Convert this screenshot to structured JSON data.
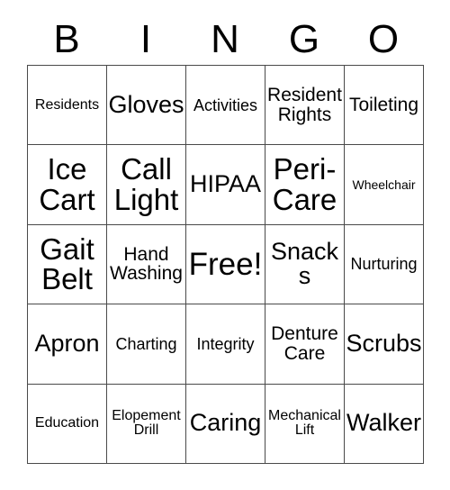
{
  "card": {
    "header_letters": [
      "B",
      "I",
      "N",
      "G",
      "O"
    ],
    "grid": {
      "rows": 5,
      "columns": 5,
      "border_color": "#4a4a4a",
      "background_color": "#ffffff",
      "text_color": "#000000"
    },
    "cells": [
      [
        {
          "label": "Residents",
          "size": "sm",
          "free": false
        },
        {
          "label": "Gloves",
          "size": "xl",
          "free": false
        },
        {
          "label": "Activities",
          "size": "md",
          "free": false
        },
        {
          "label": "Resident Rights",
          "size": "lg",
          "free": false
        },
        {
          "label": "Toileting",
          "size": "lg",
          "free": false
        }
      ],
      [
        {
          "label": "Ice Cart",
          "size": "xxl",
          "free": false
        },
        {
          "label": "Call Light",
          "size": "xxl",
          "free": false
        },
        {
          "label": "HIPAA",
          "size": "xl",
          "free": false
        },
        {
          "label": "Peri-Care",
          "size": "xxl",
          "free": false
        },
        {
          "label": "Wheelchair",
          "size": "xs",
          "free": false
        }
      ],
      [
        {
          "label": "Gait Belt",
          "size": "xxl",
          "free": false
        },
        {
          "label": "Hand Washing",
          "size": "lg",
          "free": false
        },
        {
          "label": "Free!",
          "size": "free",
          "free": true
        },
        {
          "label": "Snacks",
          "size": "xl",
          "free": false
        },
        {
          "label": "Nurturing",
          "size": "md",
          "free": false
        }
      ],
      [
        {
          "label": "Apron",
          "size": "xl",
          "free": false
        },
        {
          "label": "Charting",
          "size": "md",
          "free": false
        },
        {
          "label": "Integrity",
          "size": "md",
          "free": false
        },
        {
          "label": "Denture Care",
          "size": "lg",
          "free": false
        },
        {
          "label": "Scrubs",
          "size": "xl",
          "free": false
        }
      ],
      [
        {
          "label": "Education",
          "size": "sm",
          "free": false
        },
        {
          "label": "Elopement Drill",
          "size": "sm",
          "free": false
        },
        {
          "label": "Caring",
          "size": "xl",
          "free": false
        },
        {
          "label": "Mechanical Lift",
          "size": "sm",
          "free": false
        },
        {
          "label": "Walker",
          "size": "xl",
          "free": false
        }
      ]
    ]
  }
}
